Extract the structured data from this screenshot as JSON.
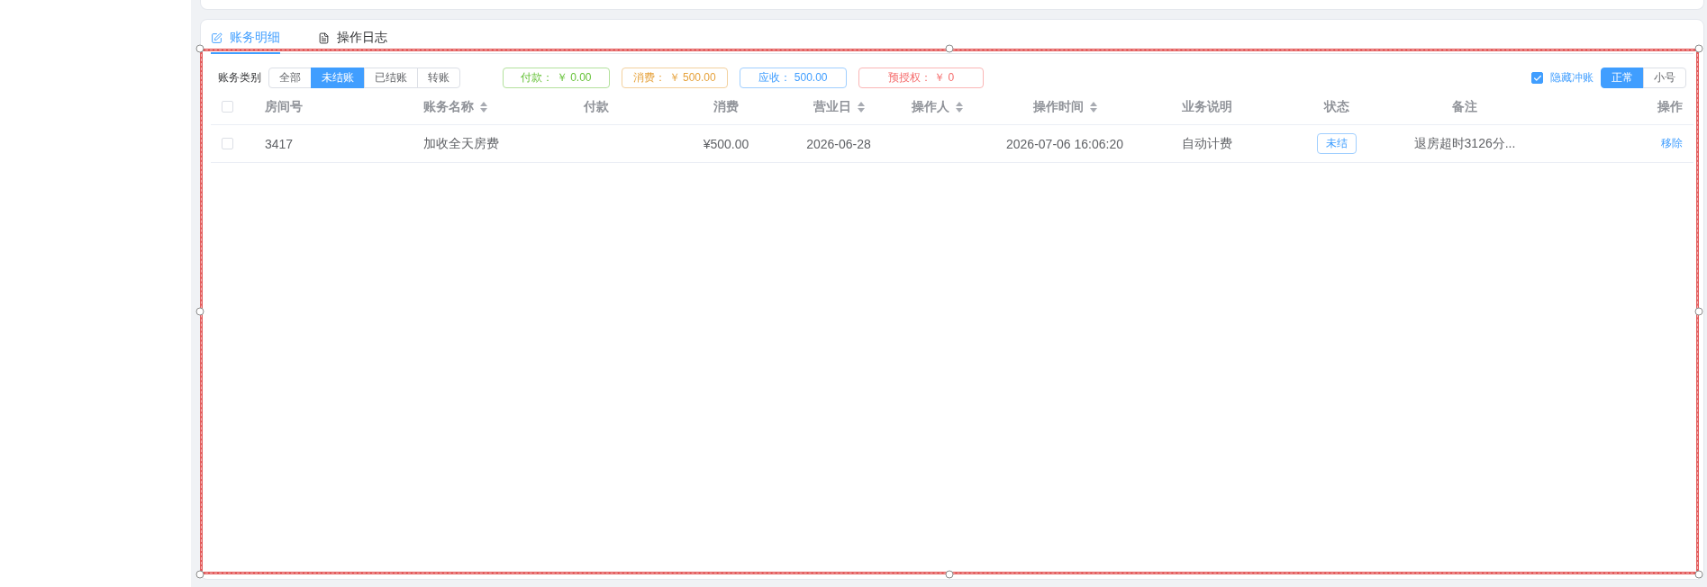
{
  "tabs": [
    {
      "label": "账务明细",
      "selected": true
    },
    {
      "label": "操作日志",
      "selected": false
    }
  ],
  "tab_pane": {
    "selected": true
  },
  "toolbar": {
    "filter": {
      "label": "账务类别",
      "options": [
        {
          "label": "全部",
          "selected": false
        },
        {
          "label": "未结账",
          "selected": true
        },
        {
          "label": "已结账",
          "selected": false
        },
        {
          "label": "转账",
          "selected": false
        }
      ]
    },
    "summary": [
      {
        "label": "付款： ￥ 0.00",
        "color": "#67c23a"
      },
      {
        "label": "消费： ￥ 500.00",
        "color": "#e6a23c"
      },
      {
        "label": "应收： 500.00",
        "color": "#409eff"
      },
      {
        "label": "预授权： ￥ 0",
        "color": "#f56c6c"
      }
    ],
    "hide_reversal": {
      "label": "隐藏冲账",
      "checked": true
    },
    "size_options": [
      {
        "label": "正常",
        "selected": true
      },
      {
        "label": "小号",
        "selected": false
      }
    ]
  },
  "table": {
    "select_all": {
      "checked": false
    },
    "columns": [
      {
        "label": "房间号",
        "sortable": false
      },
      {
        "label": "账务名称",
        "sortable": true
      },
      {
        "label": "付款",
        "sortable": false
      },
      {
        "label": "消费",
        "sortable": false
      },
      {
        "label": "营业日",
        "sortable": true
      },
      {
        "label": "操作人",
        "sortable": true
      },
      {
        "label": "操作时间",
        "sortable": true
      },
      {
        "label": "业务说明",
        "sortable": false
      },
      {
        "label": "状态",
        "sortable": false
      },
      {
        "label": "备注",
        "sortable": false
      },
      {
        "label": "操作",
        "sortable": false
      }
    ],
    "rows": [
      {
        "checked": false,
        "room": "3417",
        "item": "加收全天房费",
        "consumption": "¥500.00",
        "business_date": "2026-06-28",
        "operated_at": "2026-07-06 16:06:20",
        "description": "自动计费",
        "status": "未结",
        "remark": "退房超时3126分...",
        "action": "移除"
      }
    ]
  }
}
